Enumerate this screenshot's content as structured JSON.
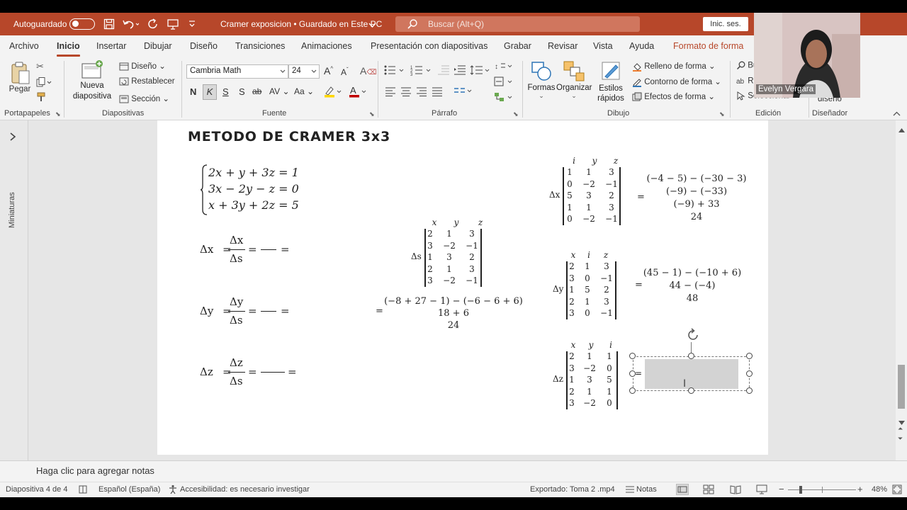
{
  "window": {
    "autosave_label": "Autoguardado",
    "doc_title": "Cramer exposicion • Guardado en Este PC",
    "search_placeholder": "Buscar (Alt+Q)",
    "signin_label": "Inic. ses.",
    "brand_color": "#b7472a"
  },
  "tabs": [
    "Archivo",
    "Inicio",
    "Insertar",
    "Dibujar",
    "Diseño",
    "Transiciones",
    "Animaciones",
    "Presentación con diapositivas",
    "Grabar",
    "Revisar",
    "Vista",
    "Ayuda",
    "Formato de forma"
  ],
  "active_tab": "Inicio",
  "ribbon": {
    "paste_label": "Pegar",
    "clipboard_group": "Portapapeles",
    "new_slide_label_1": "Nueva",
    "new_slide_label_2": "diapositiva",
    "layout_label": "Diseño",
    "reset_label": "Restablecer",
    "section_label": "Sección",
    "slides_group": "Diapositivas",
    "font_name": "Cambria Math",
    "font_size": "24",
    "font_group": "Fuente",
    "bold": "N",
    "italic": "K",
    "underline": "S",
    "shadow": "S",
    "strike": "ab",
    "spacing": "AV",
    "case": "Aa",
    "paragraph_group": "Párrafo",
    "shapes_label": "Formas",
    "arrange_label": "Organizar",
    "styles_label_1": "Estilos",
    "styles_label_2": "rápidos",
    "fill_label": "Relleno de forma",
    "outline_label": "Contorno de forma",
    "effects_label": "Efectos de forma",
    "drawing_group": "Dibujo",
    "find_label": "Bu",
    "replace_label": "Re",
    "select_label": "Seleccionar",
    "editing_group": "Edición",
    "designer_label": "diseño",
    "designer_group": "Diseñador"
  },
  "video": {
    "presenter_name": "Evelyn Vergara"
  },
  "left_pane": {
    "label": "Miniaturas"
  },
  "slide": {
    "title": "METODO DE CRAMER 3x3",
    "system": [
      "2x + y + 3z = 1",
      "3x − 2y − z = 0",
      "x + 3y + 2z = 5"
    ],
    "delta_x_formula": {
      "lhs": "Δx",
      "num": "Δx",
      "den": "Δs"
    },
    "delta_y_formula": {
      "lhs": "Δy",
      "num": "Δy",
      "den": "Δs"
    },
    "delta_z_formula": {
      "lhs": "Δz",
      "num": "Δz",
      "den": "Δs"
    },
    "ds_matrix": {
      "label": "Δs",
      "headers": [
        "x",
        "y",
        "z"
      ],
      "rows": [
        [
          "2",
          "1",
          "3"
        ],
        [
          "3",
          "−2",
          "−1"
        ],
        [
          "1",
          "3",
          "2"
        ],
        [
          "2",
          "1",
          "3"
        ],
        [
          "3",
          "−2",
          "−1"
        ]
      ],
      "calc": [
        "(−8 + 27 − 1) − (−6 − 6 + 6)",
        "18 + 6",
        "24"
      ]
    },
    "dx_matrix": {
      "label": "Δx",
      "headers": [
        "i",
        "y",
        "z"
      ],
      "rows": [
        [
          "1",
          "1",
          "3"
        ],
        [
          "0",
          "−2",
          "−1"
        ],
        [
          "5",
          "3",
          "2"
        ],
        [
          "1",
          "1",
          "3"
        ],
        [
          "0",
          "−2",
          "−1"
        ]
      ],
      "calc": [
        "(−4 − 5) − (−30 − 3)",
        "(−9) − (−33)",
        "(−9) + 33",
        "24"
      ]
    },
    "dy_matrix": {
      "label": "Δy",
      "headers": [
        "x",
        "i",
        "z"
      ],
      "rows": [
        [
          "2",
          "1",
          "3"
        ],
        [
          "3",
          "0",
          "−1"
        ],
        [
          "1",
          "5",
          "2"
        ],
        [
          "2",
          "1",
          "3"
        ],
        [
          "3",
          "0",
          "−1"
        ]
      ],
      "calc": [
        "(45 − 1) − (−10 + 6)",
        "44 − (−4)",
        "48"
      ]
    },
    "dz_matrix": {
      "label": "Δz",
      "headers": [
        "x",
        "y",
        "i"
      ],
      "rows": [
        [
          "2",
          "1",
          "1"
        ],
        [
          "3",
          "−2",
          "0"
        ],
        [
          "1",
          "3",
          "5"
        ],
        [
          "2",
          "1",
          "1"
        ],
        [
          "3",
          "−2",
          "0"
        ]
      ]
    }
  },
  "notes_placeholder": "Haga clic para agregar notas",
  "status": {
    "slide_info": "Diapositiva 4 de 4",
    "language": "Español (España)",
    "accessibility": "Accesibilidad: es necesario investigar",
    "export": "Exportado: Toma 2 .mp4",
    "notes_label": "Notas",
    "zoom": "48%"
  }
}
